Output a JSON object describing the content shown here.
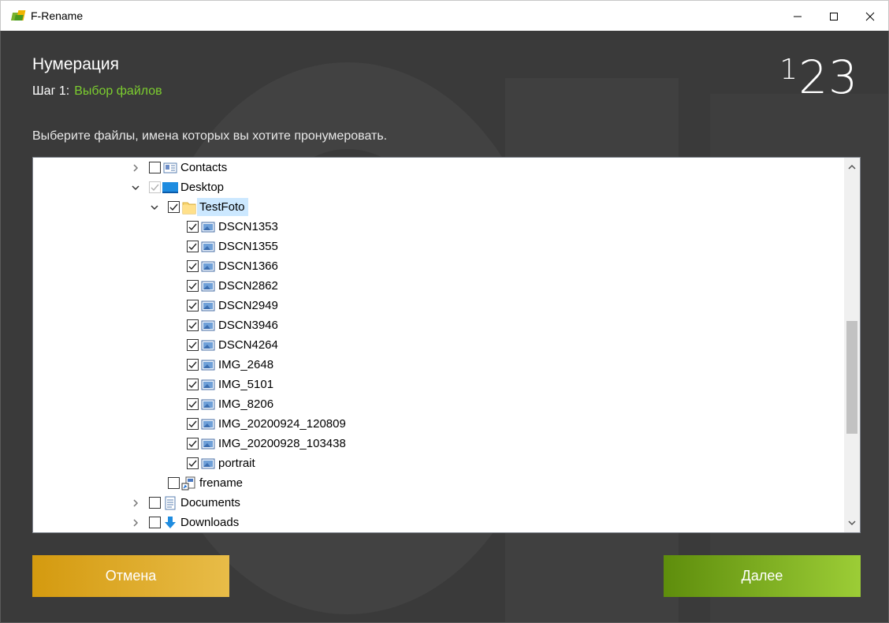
{
  "window": {
    "title": "F-Rename",
    "minimize": "minimize",
    "maximize": "maximize",
    "close": "close"
  },
  "header": {
    "heading": "Нумерация",
    "step_prefix": "Шаг 1:",
    "step_name": "Выбор файлов",
    "logo_one": "1",
    "logo_rest": "23"
  },
  "instruction": "Выберите файлы, имена которых вы хотите пронумеровать.",
  "tree": {
    "items": [
      {
        "label": "Contacts",
        "level": 0,
        "expander": "collapsed",
        "checked": false,
        "icon": "contacts-icon"
      },
      {
        "label": "Desktop",
        "level": 0,
        "expander": "expanded",
        "checked": "partial",
        "icon": "desktop-icon"
      },
      {
        "label": "TestFoto",
        "level": 1,
        "expander": "expanded",
        "checked": true,
        "icon": "folder-icon",
        "selected": true
      },
      {
        "label": "DSCN1353",
        "level": 2,
        "expander": "none",
        "checked": true,
        "icon": "image-file-icon"
      },
      {
        "label": "DSCN1355",
        "level": 2,
        "expander": "none",
        "checked": true,
        "icon": "image-file-icon"
      },
      {
        "label": "DSCN1366",
        "level": 2,
        "expander": "none",
        "checked": true,
        "icon": "image-file-icon"
      },
      {
        "label": "DSCN2862",
        "level": 2,
        "expander": "none",
        "checked": true,
        "icon": "image-file-icon"
      },
      {
        "label": "DSCN2949",
        "level": 2,
        "expander": "none",
        "checked": true,
        "icon": "image-file-icon"
      },
      {
        "label": "DSCN3946",
        "level": 2,
        "expander": "none",
        "checked": true,
        "icon": "image-file-icon"
      },
      {
        "label": "DSCN4264",
        "level": 2,
        "expander": "none",
        "checked": true,
        "icon": "image-file-icon"
      },
      {
        "label": "IMG_2648",
        "level": 2,
        "expander": "none",
        "checked": true,
        "icon": "image-file-icon"
      },
      {
        "label": "IMG_5101",
        "level": 2,
        "expander": "none",
        "checked": true,
        "icon": "image-file-icon"
      },
      {
        "label": "IMG_8206",
        "level": 2,
        "expander": "none",
        "checked": true,
        "icon": "image-file-icon"
      },
      {
        "label": "IMG_20200924_120809",
        "level": 2,
        "expander": "none",
        "checked": true,
        "icon": "image-file-icon"
      },
      {
        "label": "IMG_20200928_103438",
        "level": 2,
        "expander": "none",
        "checked": true,
        "icon": "image-file-icon"
      },
      {
        "label": "portrait",
        "level": 2,
        "expander": "none",
        "checked": true,
        "icon": "image-file-icon"
      },
      {
        "label": "frename",
        "level": 1,
        "expander": "none",
        "checked": false,
        "icon": "frename-shortcut-icon"
      },
      {
        "label": "Documents",
        "level": 0,
        "expander": "collapsed",
        "checked": false,
        "icon": "documents-icon"
      },
      {
        "label": "Downloads",
        "level": 0,
        "expander": "collapsed",
        "checked": false,
        "icon": "downloads-icon"
      }
    ]
  },
  "buttons": {
    "cancel": "Отмена",
    "next": "Далее"
  },
  "colors": {
    "background": "#3a3a3a",
    "accent_green": "#7ccd2f",
    "cancel_button": "#d49a0f",
    "next_button": "#5e8d0c",
    "selection": "#cce8ff"
  }
}
